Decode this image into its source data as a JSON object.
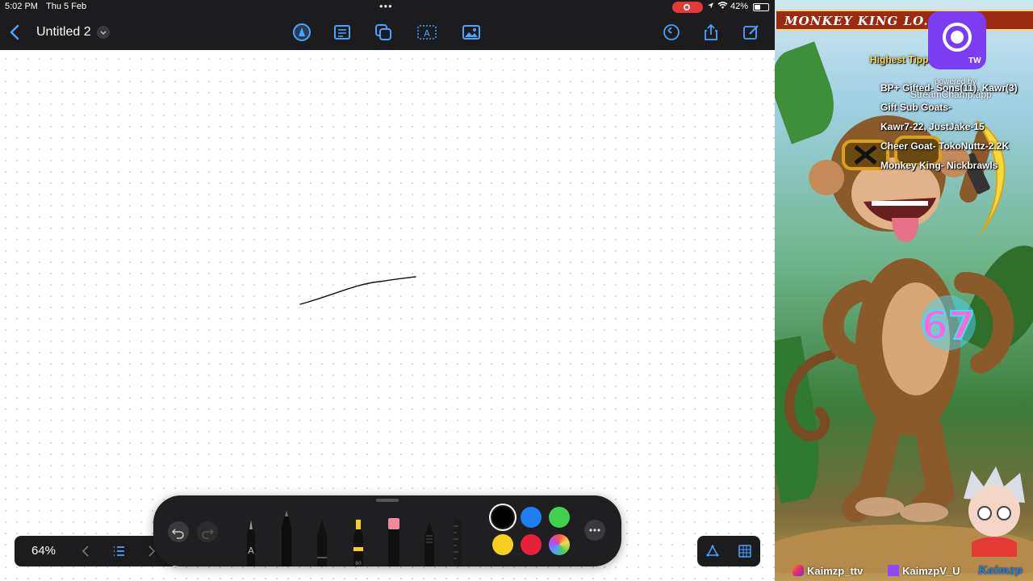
{
  "status": {
    "time": "5:02 PM",
    "date": "Thu 5 Feb",
    "battery_pct": "42%",
    "battery_level": 0.42
  },
  "document": {
    "title": "Untitled 2"
  },
  "toolbar": {
    "center_tools": [
      "pencil-tool-icon",
      "note-icon",
      "shapes-icon",
      "text-box-icon",
      "image-icon"
    ],
    "right_tools": [
      "history-icon",
      "share-icon",
      "compose-icon"
    ]
  },
  "bottom": {
    "zoom": "64%"
  },
  "pencil_bar": {
    "tools": [
      "fountain-pen",
      "pen",
      "pencil",
      "highlighter",
      "eraser",
      "lasso",
      "ruler"
    ],
    "colors": [
      "#000000",
      "#1f7df2",
      "#3fd14f",
      "#f7cf1f",
      "#e8213a",
      "rainbow"
    ],
    "selected_color": "#000000",
    "pen_label": "A",
    "highlighter_label": "80"
  },
  "stream_overlay": {
    "banner": "MONKEY KING LO... 'ALL!",
    "highest_tipper": "Highest Tipp... 2x ($120)",
    "bp_gifted": "BP+ Gifted- Sons(11), Kawr(3)",
    "gift_sub_goats": "Gift Sub Goats-",
    "gift_sub_names": "Kawr7-22, JustJake-15",
    "cheer_goat": "Cheer Goat- TokoNuttz-2.2K",
    "monkey_king": "Monkey King- Nickbrawls",
    "badge_label": "TW",
    "powered_by": "powered by",
    "powered_app": "StreamChamp.app",
    "chest_number": "67",
    "instagram_handle": "Kaimzp_ttv",
    "twitch_handle": "KaimzpV_U",
    "signature": "Kaimzp"
  }
}
